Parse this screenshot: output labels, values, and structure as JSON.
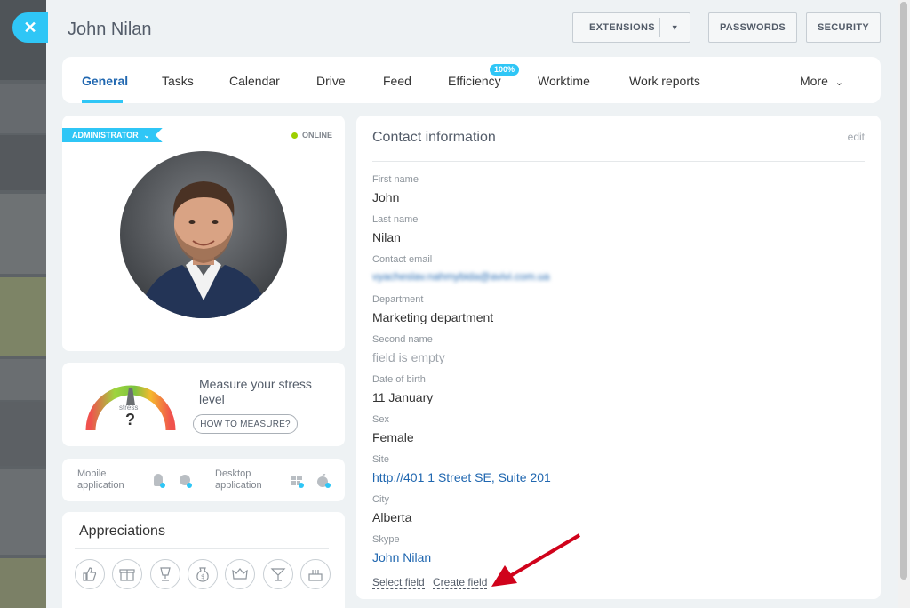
{
  "title": "John Nilan",
  "header_buttons": {
    "extensions": "EXTENSIONS",
    "passwords": "PASSWORDS",
    "security": "SECURITY"
  },
  "tabs": [
    {
      "label": "General"
    },
    {
      "label": "Tasks"
    },
    {
      "label": "Calendar"
    },
    {
      "label": "Drive"
    },
    {
      "label": "Feed"
    },
    {
      "label": "Efficiency"
    },
    {
      "label": "Worktime"
    },
    {
      "label": "Work reports"
    },
    {
      "label": "More"
    }
  ],
  "efficiency_badge": "100%",
  "profile": {
    "role": "ADMINISTRATOR",
    "status": "ONLINE"
  },
  "stress": {
    "gauge_label": "stress",
    "gauge_value": "?",
    "text": "Measure your stress level",
    "button": "HOW TO MEASURE?"
  },
  "apps": {
    "mobile": "Mobile application",
    "desktop": "Desktop application"
  },
  "appreciations": {
    "title": "Appreciations",
    "icons": [
      "thumbs-up-icon",
      "gift-icon",
      "trophy-icon",
      "money-bag-icon",
      "crown-icon",
      "cocktail-icon",
      "cake-icon"
    ]
  },
  "contact": {
    "title": "Contact information",
    "edit": "edit",
    "fields": [
      {
        "label": "First name",
        "value": "John"
      },
      {
        "label": "Last name",
        "value": "Nilan"
      },
      {
        "label": "Contact email",
        "value": "vyacheslav.nahmybida@avivi.com.ua"
      },
      {
        "label": "Department",
        "value": "Marketing department"
      },
      {
        "label": "Second name",
        "value": "field is empty"
      },
      {
        "label": "Date of birth",
        "value": "11 January"
      },
      {
        "label": "Sex",
        "value": "Female"
      },
      {
        "label": "Site",
        "value": "http://401 1 Street SE, Suite 201"
      },
      {
        "label": "City",
        "value": "Alberta"
      },
      {
        "label": "Skype",
        "value": "John Nilan"
      }
    ],
    "select_field": "Select field",
    "create_field": "Create field"
  },
  "colors": {
    "accent": "#2fc6f6",
    "link": "#2067b0",
    "arrow": "#d0021b"
  }
}
